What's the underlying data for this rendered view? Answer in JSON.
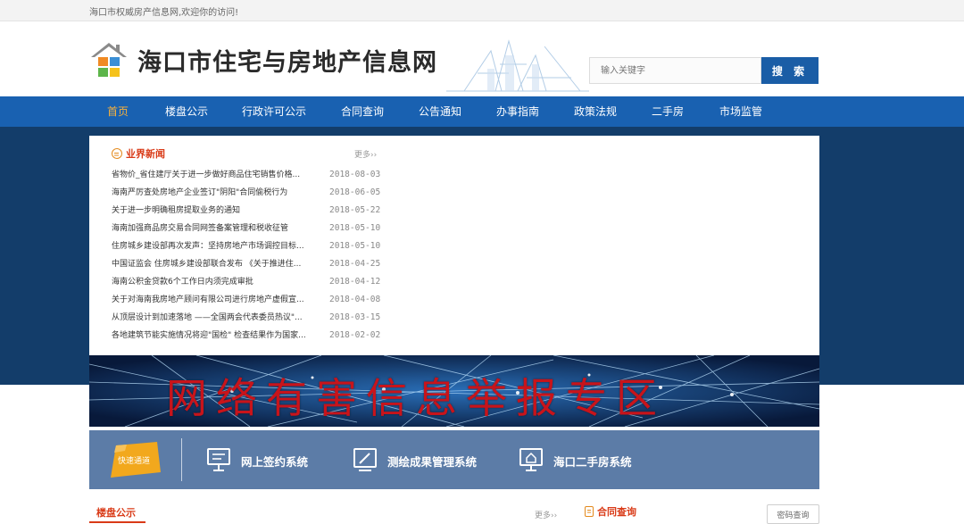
{
  "topbar": {
    "welcome": "海口市权威房产信息网,欢迎你的访问!"
  },
  "header": {
    "site_title": "海口市住宅与房地产信息网",
    "search_placeholder": "输入关键字",
    "search_button": "搜 索"
  },
  "nav": {
    "items": [
      {
        "label": "首页",
        "active": true
      },
      {
        "label": "楼盘公示"
      },
      {
        "label": "行政许可公示"
      },
      {
        "label": "合同查询"
      },
      {
        "label": "公告通知"
      },
      {
        "label": "办事指南"
      },
      {
        "label": "政策法规"
      },
      {
        "label": "二手房"
      },
      {
        "label": "市场监管"
      }
    ]
  },
  "news": {
    "heading": "业界新闻",
    "more": "更多››",
    "items": [
      {
        "title": "省物价_省住建厅关于进一步做好商品住宅销售价格...",
        "date": "2018-08-03"
      },
      {
        "title": "海南严厉查处房地产企业签订\"阴阳\"合同偷税行为",
        "date": "2018-06-05"
      },
      {
        "title": "关于进一步明确租房提取业务的通知",
        "date": "2018-05-22"
      },
      {
        "title": "海南加强商品房交易合同网签备案管理和税收征管",
        "date": "2018-05-10"
      },
      {
        "title": "住房城乡建设部再次发声：坚持房地产市场调控目标...",
        "date": "2018-05-10"
      },
      {
        "title": "中国证监会 住房城乡建设部联合发布 《关于推进住...",
        "date": "2018-04-25"
      },
      {
        "title": "海南公积金贷款6个工作日内须完成审批",
        "date": "2018-04-12"
      },
      {
        "title": "关于对海南我房地产顾问有限公司进行房地产虚假宣...",
        "date": "2018-04-08"
      },
      {
        "title": "从顶层设计到加速落地 ——全国两会代表委员热议\"...",
        "date": "2018-03-15"
      },
      {
        "title": "各地建筑节能实施情况将迎\"国检\" 检查结果作为国家...",
        "date": "2018-02-02"
      }
    ]
  },
  "banner": {
    "text": "网络有害信息举报专区"
  },
  "quick": {
    "badge": "快速通道",
    "items": [
      {
        "label": "网上签约系统",
        "icon": "monitor-sign-icon"
      },
      {
        "label": "测绘成果管理系统",
        "icon": "pen-edit-icon"
      },
      {
        "label": "海口二手房系统",
        "icon": "house-monitor-icon"
      }
    ]
  },
  "bottom": {
    "listing_title": "楼盘公示",
    "more": "更多››",
    "contract_title": "合同查询",
    "password_button": "密码查询"
  },
  "colors": {
    "nav_bg": "#1961b1",
    "band_bg": "#133d6a",
    "accent_red": "#d93a17",
    "active_nav": "#f7b13d"
  }
}
